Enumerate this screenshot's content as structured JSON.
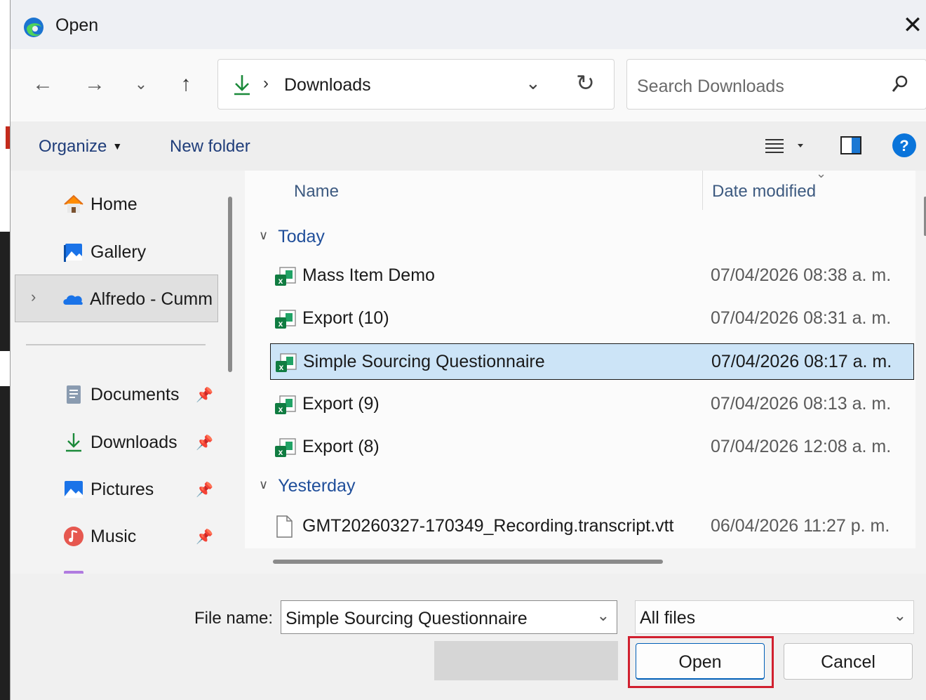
{
  "window": {
    "title": "Open"
  },
  "address": {
    "crumb": "Downloads",
    "separator": "›"
  },
  "search": {
    "placeholder": "Search Downloads"
  },
  "toolbar": {
    "organize": "Organize",
    "new_folder": "New folder"
  },
  "nav": {
    "items": [
      {
        "label": "Home",
        "icon": "home-icon"
      },
      {
        "label": "Gallery",
        "icon": "gallery-icon"
      },
      {
        "label": "Alfredo - Cumm",
        "icon": "onedrive-icon"
      },
      {
        "label": "Documents",
        "icon": "documents-icon"
      },
      {
        "label": "Downloads",
        "icon": "downloads-icon"
      },
      {
        "label": "Pictures",
        "icon": "pictures-icon"
      },
      {
        "label": "Music",
        "icon": "music-icon"
      }
    ]
  },
  "columns": {
    "name": "Name",
    "date": "Date modified"
  },
  "groups": {
    "today": "Today",
    "yesterday": "Yesterday"
  },
  "files": [
    {
      "name": "Mass Item Demo",
      "date": "07/04/2026 08:38 a. m.",
      "type": "excel"
    },
    {
      "name": "Export (10)",
      "date": "07/04/2026 08:31 a. m.",
      "type": "excel"
    },
    {
      "name": "Simple Sourcing Questionnaire",
      "date": "07/04/2026 08:17 a. m.",
      "type": "excel",
      "selected": true
    },
    {
      "name": "Export (9)",
      "date": "07/04/2026 08:13 a. m.",
      "type": "excel"
    },
    {
      "name": "Export (8)",
      "date": "07/04/2026 12:08 a. m.",
      "type": "excel"
    },
    {
      "name": "GMT20260327-170349_Recording.transcript.vtt",
      "date": "06/04/2026 11:27 p. m.",
      "type": "text"
    }
  ],
  "footer": {
    "filename_label": "File name:",
    "filename_value": "Simple Sourcing Questionnaire",
    "filter_value": "All files",
    "open_label": "Open",
    "cancel_label": "Cancel"
  },
  "colors": {
    "accent": "#005fb8",
    "selection": "#cce4f7",
    "highlight": "#d1202f",
    "excel": "#107c41"
  }
}
